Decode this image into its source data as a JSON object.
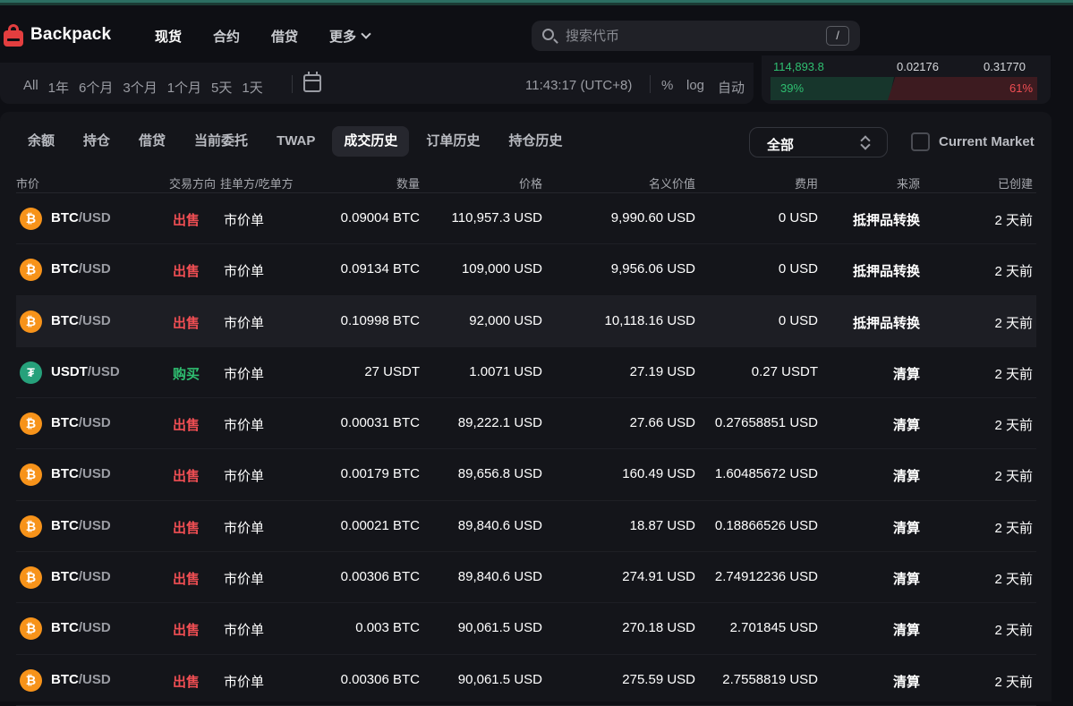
{
  "app": {
    "name": "Backpack"
  },
  "nav": {
    "items": [
      "现货",
      "合约",
      "借贷"
    ],
    "more_label": "更多"
  },
  "search": {
    "placeholder": "搜索代币",
    "shortcut": "/"
  },
  "chart_toolbar": {
    "ranges": [
      "All",
      "1年",
      "6个月",
      "3个月",
      "1个月",
      "5天",
      "1天"
    ],
    "time": "11:43:17 (UTC+8)",
    "percent_label": "%",
    "log_label": "log",
    "auto_label": "自动"
  },
  "orderbook": {
    "price": "114,893.8",
    "mid_value": "0.02176",
    "right_value": "0.31770",
    "buy_pct": "39%",
    "sell_pct": "61%",
    "colors": {
      "buy": "#2fbf71",
      "sell": "#ef4e53"
    }
  },
  "tabs": [
    "余额",
    "持仓",
    "借贷",
    "当前委托",
    "TWAP",
    "成交历史",
    "订单历史",
    "持仓历史"
  ],
  "active_tab": "成交历史",
  "filter": {
    "selected": "全部"
  },
  "current_market": {
    "label": "Current Market",
    "checked": false
  },
  "table": {
    "headers": {
      "market": "市价",
      "side": "交易方向",
      "maker_taker": "挂单方/吃单方",
      "quantity": "数量",
      "price": "价格",
      "notional": "名义价值",
      "fee": "费用",
      "source": "来源",
      "created": "已创建"
    },
    "rows": [
      {
        "icon": "btc-icon",
        "base": "BTC",
        "quote": "/USD",
        "side": "出售",
        "side_type": "sell",
        "type": "市价单",
        "qty": "0.09004 BTC",
        "price": "110,957.3 USD",
        "notional": "9,990.60 USD",
        "fee": "0 USD",
        "source": "抵押品转换",
        "created": "2 天前"
      },
      {
        "icon": "btc-icon",
        "base": "BTC",
        "quote": "/USD",
        "side": "出售",
        "side_type": "sell",
        "type": "市价单",
        "qty": "0.09134 BTC",
        "price": "109,000 USD",
        "notional": "9,956.06 USD",
        "fee": "0 USD",
        "source": "抵押品转换",
        "created": "2 天前"
      },
      {
        "icon": "btc-icon",
        "base": "BTC",
        "quote": "/USD",
        "side": "出售",
        "side_type": "sell",
        "type": "市价单",
        "qty": "0.10998 BTC",
        "price": "92,000 USD",
        "notional": "10,118.16 USD",
        "fee": "0 USD",
        "source": "抵押品转换",
        "created": "2 天前"
      },
      {
        "icon": "usdt-icon",
        "base": "USDT",
        "quote": "/USD",
        "side": "购买",
        "side_type": "buy",
        "type": "市价单",
        "qty": "27 USDT",
        "price": "1.0071 USD",
        "notional": "27.19 USD",
        "fee": "0.27 USDT",
        "source": "清算",
        "created": "2 天前"
      },
      {
        "icon": "btc-icon",
        "base": "BTC",
        "quote": "/USD",
        "side": "出售",
        "side_type": "sell",
        "type": "市价单",
        "qty": "0.00031 BTC",
        "price": "89,222.1 USD",
        "notional": "27.66 USD",
        "fee": "0.27658851 USD",
        "source": "清算",
        "created": "2 天前"
      },
      {
        "icon": "btc-icon",
        "base": "BTC",
        "quote": "/USD",
        "side": "出售",
        "side_type": "sell",
        "type": "市价单",
        "qty": "0.00179 BTC",
        "price": "89,656.8 USD",
        "notional": "160.49 USD",
        "fee": "1.60485672 USD",
        "source": "清算",
        "created": "2 天前"
      },
      {
        "icon": "btc-icon",
        "base": "BTC",
        "quote": "/USD",
        "side": "出售",
        "side_type": "sell",
        "type": "市价单",
        "qty": "0.00021 BTC",
        "price": "89,840.6 USD",
        "notional": "18.87 USD",
        "fee": "0.18866526 USD",
        "source": "清算",
        "created": "2 天前"
      },
      {
        "icon": "btc-icon",
        "base": "BTC",
        "quote": "/USD",
        "side": "出售",
        "side_type": "sell",
        "type": "市价单",
        "qty": "0.00306 BTC",
        "price": "89,840.6 USD",
        "notional": "274.91 USD",
        "fee": "2.74912236 USD",
        "source": "清算",
        "created": "2 天前"
      },
      {
        "icon": "btc-icon",
        "base": "BTC",
        "quote": "/USD",
        "side": "出售",
        "side_type": "sell",
        "type": "市价单",
        "qty": "0.003 BTC",
        "price": "90,061.5 USD",
        "notional": "270.18 USD",
        "fee": "2.701845 USD",
        "source": "清算",
        "created": "2 天前"
      },
      {
        "icon": "btc-icon",
        "base": "BTC",
        "quote": "/USD",
        "side": "出售",
        "side_type": "sell",
        "type": "市价单",
        "qty": "0.00306 BTC",
        "price": "90,061.5 USD",
        "notional": "275.59 USD",
        "fee": "2.7558819 USD",
        "source": "清算",
        "created": "2 天前"
      }
    ]
  }
}
